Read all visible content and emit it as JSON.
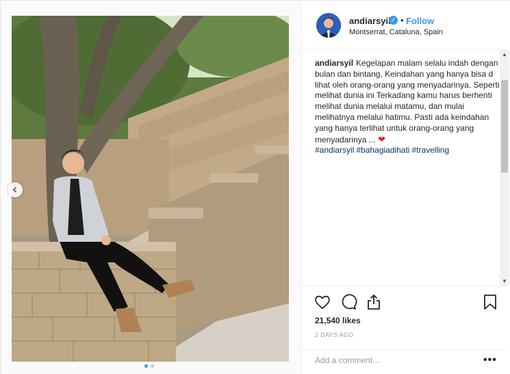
{
  "post": {
    "username": "andiarsyil",
    "verified_glyph": "✓",
    "separator": "•",
    "follow_label": "Follow",
    "location": "Montserrat, Cataluna, Spain"
  },
  "caption": {
    "username": "andiarsyil",
    "text": "Kegelapan malam selalu indah dengan bulan dan bintang, Keindahan yang hanya bisa d lihat oleh orang-orang yang menyadarinya. Seperti melihat dunia ini Terkadang kamu harus berhenti melihat dunia melalui matamu, dan mulai melihatnya melalui hatimu. Pasti ada keindahan yang hanya terlihat untuk orang-orang yang menyadarinya ...",
    "heart": "❤",
    "hashtags": [
      "#andiarsyil",
      "#bahagiadihati",
      "#travelling"
    ]
  },
  "actions": {
    "likes": "21,540 likes",
    "date": "2 DAYS AGO",
    "comment_placeholder": "Add a comment...",
    "more_label": "•••"
  },
  "carousel": {
    "total": 2,
    "current": 1
  },
  "icons": [
    "heart-icon",
    "comment-icon",
    "share-icon",
    "bookmark-icon",
    "chevron-left-icon",
    "verified-badge-icon"
  ],
  "colors": {
    "accent": "#3897f0",
    "hashtag": "#003569",
    "heart": "#e0262e",
    "text": "#262626",
    "muted": "#999999"
  }
}
